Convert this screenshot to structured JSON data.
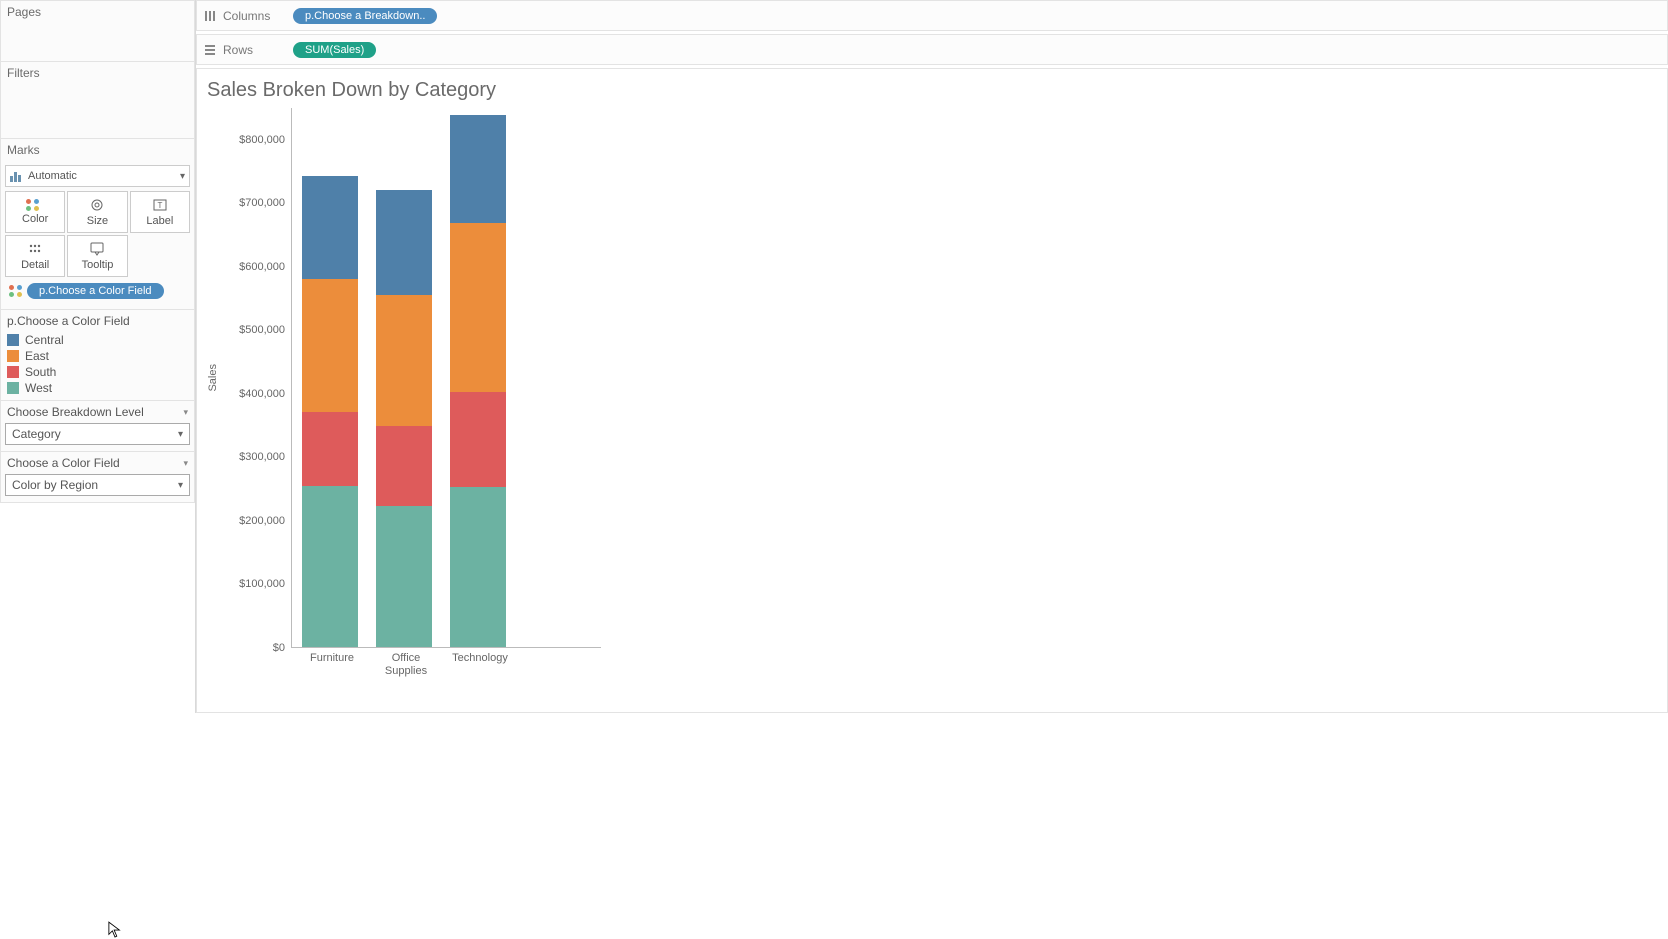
{
  "left": {
    "pages_title": "Pages",
    "filters_title": "Filters",
    "marks_title": "Marks",
    "marks_type": "Automatic",
    "mark_buttons": {
      "color": "Color",
      "size": "Size",
      "label": "Label",
      "detail": "Detail",
      "tooltip": "Tooltip"
    },
    "color_field_pill": "p.Choose a Color Field",
    "legend_title": "p.Choose a Color Field",
    "legend_items": [
      {
        "label": "Central",
        "color": "#4f80a9"
      },
      {
        "label": "East",
        "color": "#ec8d3b"
      },
      {
        "label": "South",
        "color": "#de5b5b"
      },
      {
        "label": "West",
        "color": "#6cb2a2"
      }
    ],
    "param1_title": "Choose Breakdown Level",
    "param1_value": "Category",
    "param2_title": "Choose a Color Field",
    "param2_value": "Color by Region"
  },
  "shelves": {
    "columns_label": "Columns",
    "columns_pill": "p.Choose a Breakdown..",
    "rows_label": "Rows",
    "rows_pill": "SUM(Sales)"
  },
  "viz_title": "Sales Broken Down by Category",
  "chart_data": {
    "type": "bar",
    "stacked": true,
    "title": "Sales Broken Down by Category",
    "ylabel": "Sales",
    "xlabel": "",
    "ylim": [
      0,
      850000
    ],
    "yticks": [
      "$0",
      "$100,000",
      "$200,000",
      "$300,000",
      "$400,000",
      "$500,000",
      "$600,000",
      "$700,000",
      "$800,000"
    ],
    "ytick_values": [
      0,
      100000,
      200000,
      300000,
      400000,
      500000,
      600000,
      700000,
      800000
    ],
    "categories": [
      "Furniture",
      "Office Supplies",
      "Technology"
    ],
    "series": [
      {
        "name": "West",
        "color": "#6cb2a2",
        "values": [
          253000,
          222000,
          252000
        ]
      },
      {
        "name": "South",
        "color": "#de5b5b",
        "values": [
          117000,
          126000,
          149000
        ]
      },
      {
        "name": "East",
        "color": "#ec8d3b",
        "values": [
          209000,
          206000,
          266000
        ]
      },
      {
        "name": "Central",
        "color": "#4f80a9",
        "values": [
          163000,
          165000,
          170000
        ]
      }
    ]
  }
}
